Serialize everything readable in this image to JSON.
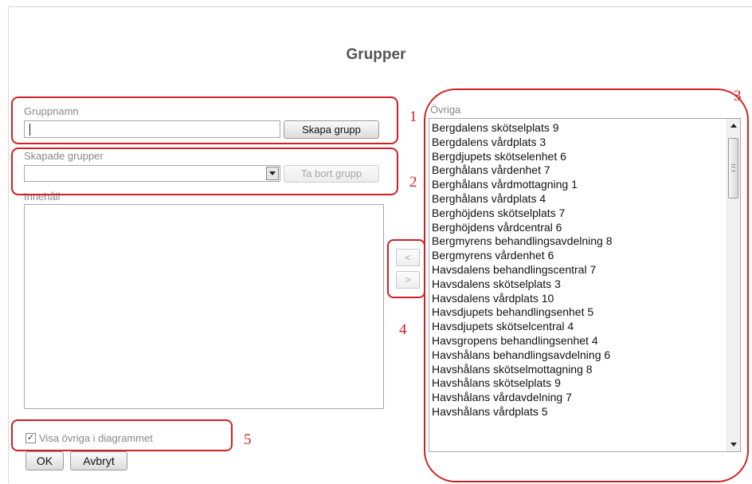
{
  "dialog": {
    "title": "Grupper",
    "group_name": {
      "label": "Gruppnamn",
      "value": "",
      "create_button": "Skapa grupp"
    },
    "created_groups": {
      "label": "Skapade grupper",
      "selected": "",
      "remove_button": "Ta bort grupp"
    },
    "content": {
      "label": "Innehåll"
    },
    "move_buttons": {
      "left": "<",
      "right": ">"
    },
    "others": {
      "label": "Övriga",
      "items": [
        "Bergdalens skötselplats 9",
        "Bergdalens vårdplats 3",
        "Bergdjupets skötselenhet 6",
        "Berghålans vårdenhet 7",
        "Berghålans vårdmottagning 1",
        "Berghålans vårdplats 4",
        "Berghöjdens skötselplats 7",
        "Berghöjdens vårdcentral 6",
        "Bergmyrens behandlingsavdelning 8",
        "Bergmyrens vårdenhet 6",
        "Havsdalens behandlingscentral 7",
        "Havsdalens skötselplats 3",
        "Havsdalens vårdplats 10",
        "Havsdjupets behandlingsenhet 5",
        "Havsdjupets skötselcentral 4",
        "Havsgropens behandlingsenhet 4",
        "Havshålans behandlingsavdelning 6",
        "Havshålans skötselmottagning 8",
        "Havshålans skötselplats 9",
        "Havshålans vårdavdelning 7",
        "Havshålans vårdplats 5"
      ]
    },
    "show_others": {
      "label": "Visa övriga i diagrammet",
      "checked": true
    },
    "ok_button": "OK",
    "cancel_button": "Avbryt"
  },
  "annotations": [
    "1",
    "2",
    "3",
    "4",
    "5"
  ],
  "colors": {
    "annotation": "#d21f26",
    "title": "#555555"
  }
}
